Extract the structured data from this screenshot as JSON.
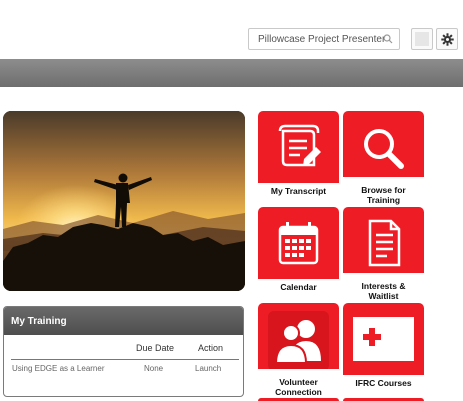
{
  "search": {
    "value": "Pillowcase Project Presenter"
  },
  "training": {
    "title": "My Training",
    "columns": {
      "due_date": "Due Date",
      "action": "Action"
    },
    "rows": [
      {
        "course": "Using EDGE as a Learner",
        "due_date": "None",
        "action": "Launch"
      }
    ]
  },
  "tiles": [
    {
      "label_line1": "My Transcript",
      "label_line2": "",
      "icon": "transcript-icon"
    },
    {
      "label_line1": "Browse for",
      "label_line2": "Training",
      "icon": "magnifier-icon"
    },
    {
      "label_line1": "Calendar",
      "label_line2": "",
      "icon": "calendar-icon"
    },
    {
      "label_line1": "Interests &",
      "label_line2": "Waitlist",
      "icon": "document-icon"
    },
    {
      "label_line1": "Volunteer",
      "label_line2": "Connection",
      "icon": "people-icon"
    },
    {
      "label_line1": "IFRC Courses",
      "label_line2": "",
      "icon": "ifrc-logo-icon"
    }
  ],
  "colors": {
    "tile_red": "#ee1c25",
    "band_grey": "#7d7d7d",
    "panel_header": "#5a5a5a"
  }
}
